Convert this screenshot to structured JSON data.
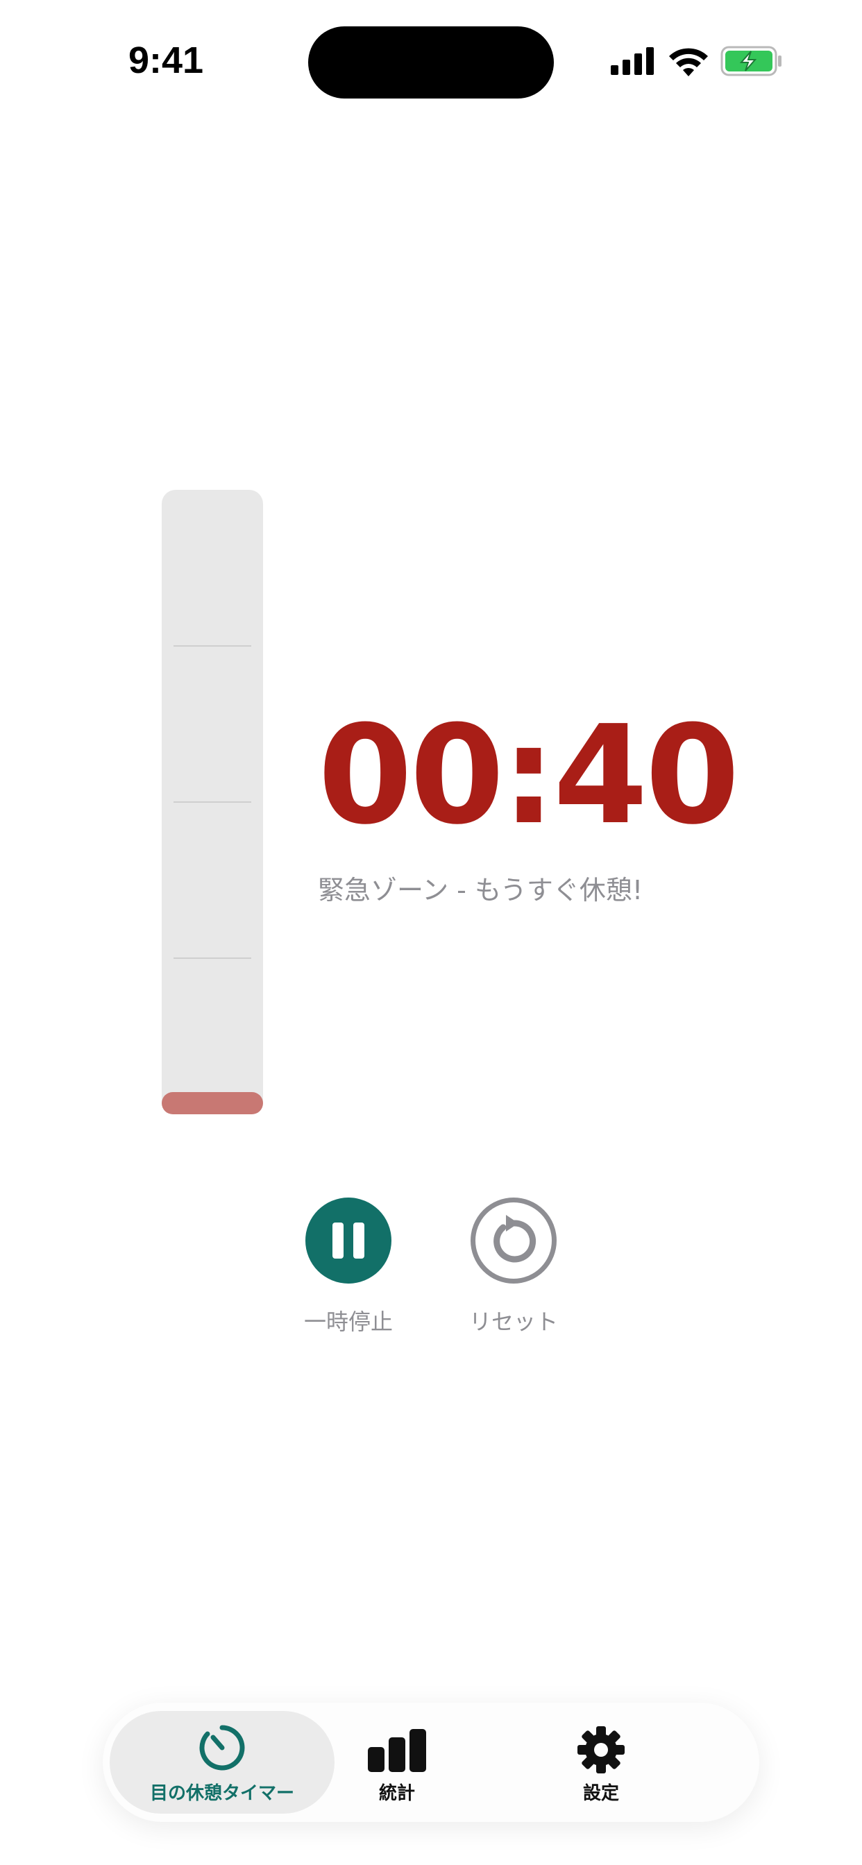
{
  "status_bar": {
    "time": "9:41"
  },
  "timer": {
    "time": "00:40",
    "message": "緊急ゾーン - もうすぐ休憩!",
    "progress_fraction": 0.035
  },
  "controls": {
    "pause_label": "一時停止",
    "reset_label": "リセット"
  },
  "tabs": [
    {
      "label": "目の休憩タイマー",
      "icon": "timer-icon",
      "active": true
    },
    {
      "label": "統計",
      "icon": "bar-chart-icon",
      "active": false
    },
    {
      "label": "設定",
      "icon": "gear-icon",
      "active": false
    }
  ],
  "colors": {
    "accent": "#127068",
    "timer_red": "#a91e17",
    "gauge_fill": "#c87873",
    "secondary_text": "#8e8e93",
    "battery_green": "#34c759"
  }
}
